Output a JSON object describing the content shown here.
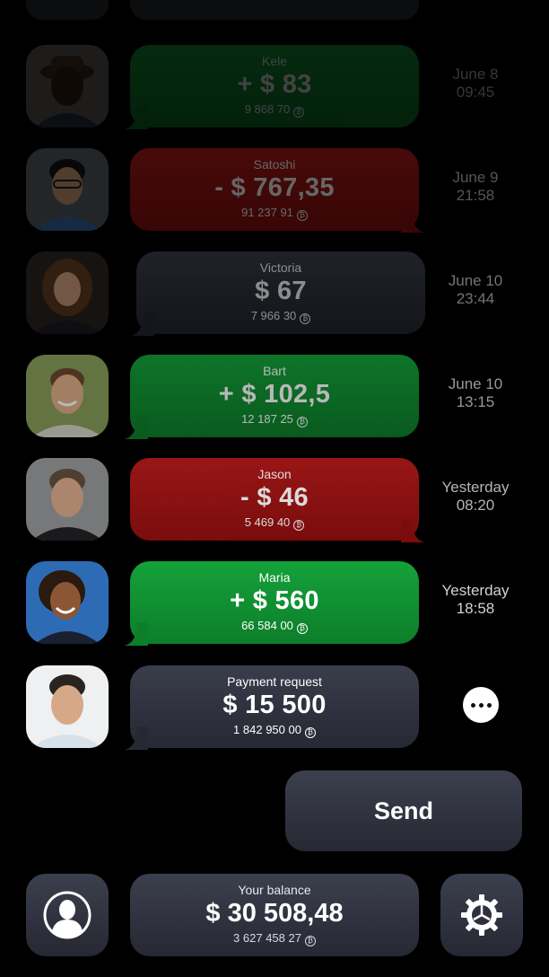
{
  "colors": {
    "credit": "#14a23a",
    "debit": "#b31a1a",
    "neutral": "#30323e",
    "background": "#000000"
  },
  "transactions": [
    {
      "name": "Kele",
      "amount": "+ $ 83",
      "coins": "9 868 70",
      "date": "June 8",
      "time": "09:45",
      "type": "credit"
    },
    {
      "name": "Satoshi",
      "amount": "- $ 767,35",
      "coins": "91 237 91",
      "date": "June 9",
      "time": "21:58",
      "type": "debit"
    },
    {
      "name": "Victoria",
      "amount": "$ 67",
      "coins": "7 966 30",
      "date": "June 10",
      "time": "23:44",
      "type": "neutral"
    },
    {
      "name": "Bart",
      "amount": "+ $ 102,5",
      "coins": "12 187 25",
      "date": "June 10",
      "time": "13:15",
      "type": "credit"
    },
    {
      "name": "Jason",
      "amount": "- $ 46",
      "coins": "5 469 40",
      "date": "Yesterday",
      "time": "08:20",
      "type": "debit"
    },
    {
      "name": "Maria",
      "amount": "+ $ 560",
      "coins": "66 584 00",
      "date": "Yesterday",
      "time": "18:58",
      "type": "credit"
    }
  ],
  "request": {
    "label": "Payment request",
    "amount": "$ 15 500",
    "coins": "1 842 950 00",
    "more_icon": "more-horizontal-icon"
  },
  "send": {
    "label": "Send"
  },
  "balance": {
    "label": "Your balance",
    "amount": "$ 30 508,48",
    "coins": "3 627 458 27"
  },
  "footer": {
    "profile_icon": "user-silhouette-icon",
    "settings_icon": "gear-icon"
  },
  "coin_icon": "coin-icon"
}
